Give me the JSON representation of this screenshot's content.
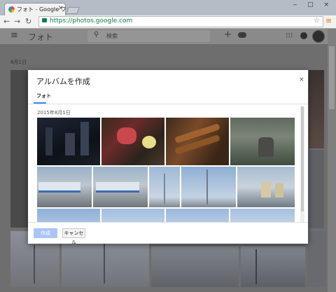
{
  "browser": {
    "tab_title": "フォト - Google フォト",
    "tab_close": "×",
    "back_icon": "arrow-left",
    "forward_icon": "arrow-right",
    "reload_icon": "reload",
    "url": "https://photos.google.com",
    "bookmark_icon": "star",
    "menu_icon": "hamburger",
    "window_buttons": "‒ □ ×"
  },
  "app": {
    "title": "フォト",
    "search_placeholder": "検索",
    "add_icon": "+",
    "apps_icon": "⋮⋮⋮",
    "background_date": "8月1日"
  },
  "dialog": {
    "title": "アルバムを作成",
    "close": "×",
    "tab_label": "フォト",
    "date": "2015年8月1日",
    "create_button": "作成",
    "cancel_button": "キャンセル"
  },
  "colors": {
    "accent": "#4285f4",
    "create_button_disabled": "#a9c4f7",
    "url_green": "#0b8043",
    "overlay": "#6e6e6e"
  }
}
